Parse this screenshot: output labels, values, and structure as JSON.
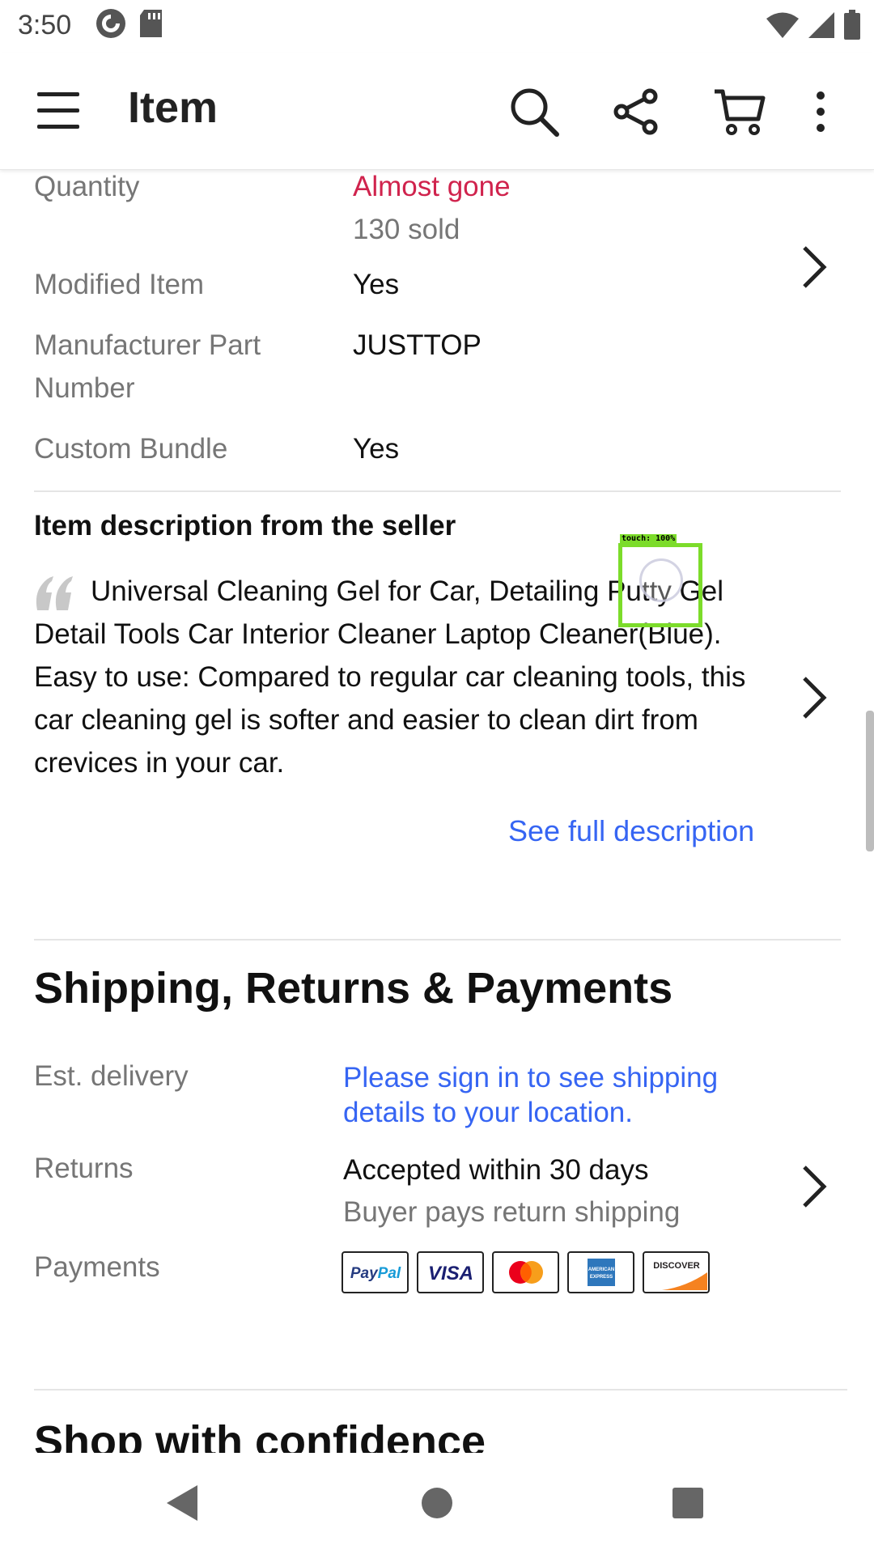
{
  "status_bar": {
    "time": "3:50",
    "left_icons": [
      "pocket-casts-icon",
      "sd-card-icon"
    ],
    "right_icons": [
      "wifi-icon",
      "signal-icon",
      "battery-icon"
    ]
  },
  "app_bar": {
    "title": "Item",
    "actions": [
      "search-icon",
      "share-icon",
      "cart-icon",
      "more-vert-icon"
    ]
  },
  "item_specifics": {
    "quantity": {
      "label": "Quantity",
      "status": "Almost gone",
      "sold": "130 sold"
    },
    "modified_item": {
      "label": "Modified Item",
      "value": "Yes"
    },
    "mpn": {
      "label": "Manufacturer Part Number",
      "value": "JUSTTOP"
    },
    "custom_bundle": {
      "label": "Custom Bundle",
      "value": "Yes"
    }
  },
  "description": {
    "heading": "Item description from the seller",
    "text": "Universal Cleaning Gel for Car, Detailing Putty Gel Detail Tools Car Interior Cleaner Laptop Cleaner(Blue). Easy to use: Compared to regular car cleaning tools, this car cleaning gel is softer and easier to clean dirt from crevices in your car.",
    "link": "See full description"
  },
  "shipping": {
    "title": "Shipping, Returns & Payments",
    "delivery_label": "Est. delivery",
    "delivery_link": "Please sign in to see shipping details to your location.",
    "returns_label": "Returns",
    "returns_value": "Accepted within 30 days",
    "returns_sub": "Buyer pays return shipping",
    "payments_label": "Payments",
    "payment_methods": [
      "PayPal",
      "VISA",
      "Mastercard",
      "AMERICAN EXPRESS",
      "DISCOVER"
    ]
  },
  "next_section": {
    "title": "Shop with confidence"
  },
  "touch_overlay": {
    "label": "touch: 100%"
  },
  "nav_bar": {
    "buttons": [
      "back-icon",
      "home-icon",
      "recents-icon"
    ]
  },
  "colors": {
    "accent_blue": "#3665f3",
    "alert_red": "#d0234d",
    "secondary_text": "#767676",
    "touch_marker": "#7cdc2a"
  }
}
